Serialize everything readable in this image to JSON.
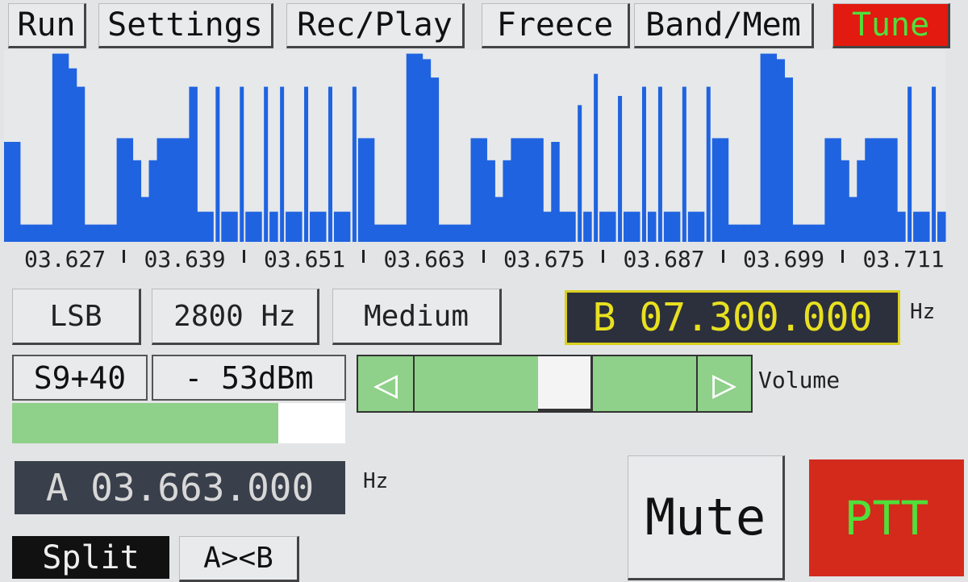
{
  "menu": {
    "run": "Run",
    "settings": "Settings",
    "rec_play": "Rec/Play",
    "freece": "Freece",
    "band_mem": "Band/Mem",
    "tune": "Tune"
  },
  "colors": {
    "spectrum": "#1f63e0",
    "tune_bg": "#e21a10",
    "tune_text": "#4fe03a",
    "vfo_b_text": "#e8e020",
    "ptt_bg": "#d42a1c",
    "meter": "#8fd08a"
  },
  "spectrum": {
    "x_range_mhz": [
      3.62,
      3.7144
    ],
    "levels": [
      0.5,
      0.5,
      0.05,
      0.05,
      0.05,
      0.05,
      0.98,
      0.98,
      0.9,
      0.8,
      0.05,
      0.05,
      0.05,
      0.05,
      0.52,
      0.52,
      0.4,
      0.2,
      0.4,
      0.52,
      0.52,
      0.52,
      0.52,
      0.8,
      0.12,
      0.12,
      0.8,
      0.12,
      0.12,
      0.8,
      0.12,
      0.12,
      0.8,
      0.12,
      0.8,
      0.12,
      0.12,
      0.8,
      0.12,
      0.12,
      0.8,
      0.12,
      0.12,
      0.8,
      0.52,
      0.52,
      0.05,
      0.05,
      0.05,
      0.05,
      0.98,
      0.98,
      0.95,
      0.85,
      0.05,
      0.05,
      0.05,
      0.05,
      0.52,
      0.52,
      0.4,
      0.2,
      0.4,
      0.52,
      0.52,
      0.52,
      0.52,
      0.12,
      0.5,
      0.12,
      0.12,
      0.7,
      0.12,
      0.87,
      0.12,
      0.12,
      0.75,
      0.12,
      0.12,
      0.8,
      0.12,
      0.8,
      0.12,
      0.12,
      0.8,
      0.12,
      0.12,
      0.8,
      0.52,
      0.52,
      0.05,
      0.05,
      0.05,
      0.05,
      0.98,
      0.98,
      0.95,
      0.85,
      0.05,
      0.05,
      0.05,
      0.05,
      0.52,
      0.52,
      0.4,
      0.2,
      0.4,
      0.52,
      0.52,
      0.52,
      0.52,
      0.12,
      0.8,
      0.12,
      0.12,
      0.8,
      0.12
    ]
  },
  "freq_labels": [
    "03.627",
    "03.639",
    "03.651",
    "03.663",
    "03.675",
    "03.687",
    "03.699",
    "03.711"
  ],
  "mode": "LSB",
  "bandwidth": "2800 Hz",
  "agc": "Medium",
  "vfo_b": "B 07.300.000",
  "vfo_b_unit": "Hz",
  "s_meter": "S9+40",
  "dbm": "- 53dBm",
  "meter_level": 0.8,
  "volume": {
    "label": "Volume",
    "level": 0.55
  },
  "vfo_a": "A 03.663.000",
  "vfo_a_unit": "Hz",
  "mute": "Mute",
  "ptt": "PTT",
  "split": "Split",
  "swap": "A><B"
}
